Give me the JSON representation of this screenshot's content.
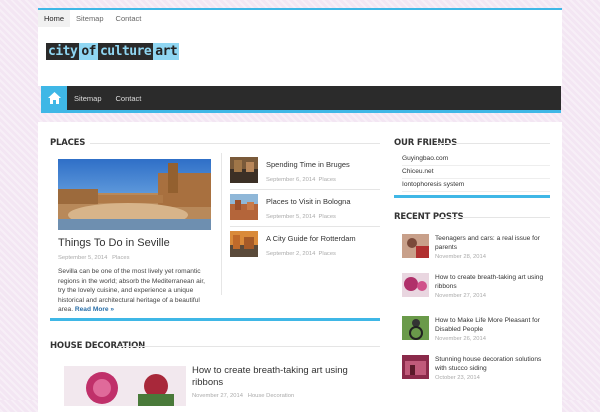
{
  "colors": {
    "accent": "#3fb7e6",
    "nav_bg": "#2b2b2b",
    "link": "#2a6fa8"
  },
  "topnav": {
    "items": [
      {
        "label": "Home"
      },
      {
        "label": "Sitemap"
      },
      {
        "label": "Contact"
      }
    ]
  },
  "logo": {
    "part1": "city",
    "part2": "of",
    "part3": "culture",
    "part4": "art"
  },
  "mainnav": {
    "home_icon": "home-icon",
    "items": [
      {
        "label": "Sitemap"
      },
      {
        "label": "Contact"
      }
    ]
  },
  "places": {
    "title": "PLACES",
    "featured": {
      "title": "Things To Do in Seville",
      "date": "September 5, 2014",
      "category": "Places",
      "excerpt": "Sevilla can be one of the most lively yet romantic regions in the world; absorb the Mediterranean air, try the lovely cuisine, and experience a unique historical and architectural heritage of a beautiful area.",
      "read_more": "Read More »"
    },
    "items": [
      {
        "title": "Spending Time in Bruges",
        "date": "September 6, 2014",
        "category": "Places"
      },
      {
        "title": "Places to Visit in Bologna",
        "date": "September 5, 2014",
        "category": "Places"
      },
      {
        "title": "A City Guide for Rotterdam",
        "date": "September 2, 2014",
        "category": "Places"
      }
    ]
  },
  "friends": {
    "title": "OUR FRIENDS",
    "items": [
      {
        "label": "Guyingbao.com"
      },
      {
        "label": "Chiceu.net"
      },
      {
        "label": "Iontophoresis system"
      }
    ]
  },
  "recent_posts": {
    "title": "RECENT POSTS",
    "items": [
      {
        "title": "Teenagers and cars: a real issue for parents",
        "date": "November 28, 2014"
      },
      {
        "title": "How to create breath-taking art using ribbons",
        "date": "November 27, 2014"
      },
      {
        "title": "How to Make Life More Pleasant for Disabled People",
        "date": "November 26, 2014"
      },
      {
        "title": "Stunning house decoration solutions with stucco siding",
        "date": "October 23, 2014"
      }
    ]
  },
  "house": {
    "title": "HOUSE DECORATION",
    "post": {
      "title": "How to create breath-taking art using ribbons",
      "date": "November 27, 2014",
      "category": "House Decoration"
    }
  }
}
